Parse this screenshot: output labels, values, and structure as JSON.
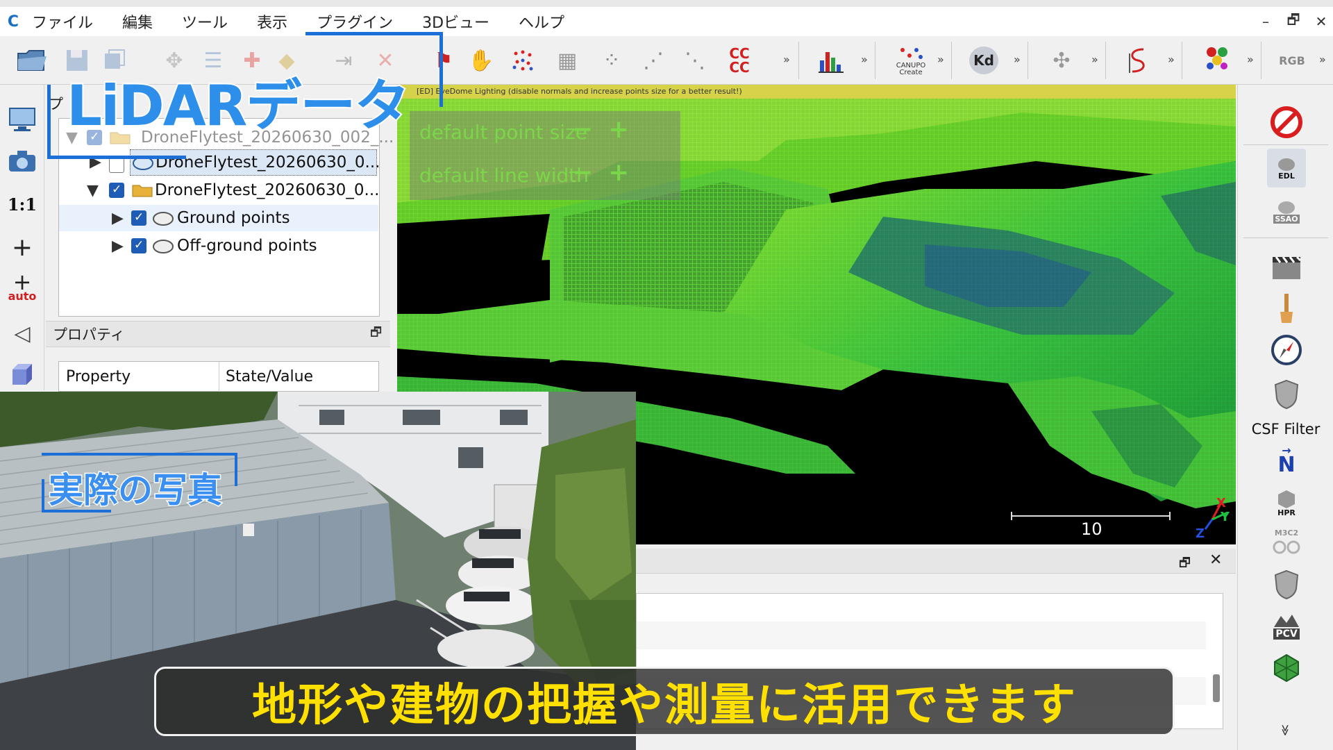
{
  "menu": {
    "logo": "C",
    "items": [
      "ファイル",
      "編集",
      "ツール",
      "表示",
      "プラグイン",
      "3Dビュー",
      "ヘルプ"
    ]
  },
  "window_controls": {
    "minimize": "–",
    "restore": "🗗",
    "close": "✕"
  },
  "toolbar": {
    "overflow": "»",
    "icons": [
      "open-folder-icon",
      "save-icon",
      "clone-icon",
      "translate-icon",
      "list-icon",
      "add-point-icon",
      "color-icon",
      "export-icon",
      "delete-icon",
      "sf-icon",
      "segment-icon",
      "hand-icon",
      "noise-icon",
      "mesh-icon",
      "scatter-icon",
      "subsample-icon",
      "sparse-icon",
      "cc-compare-icon",
      "histogram-icon",
      "canupo-create-icon",
      "kdtree-icon",
      "puzzle-icon",
      "spline-icon",
      "train-icon",
      "rgb-icon"
    ],
    "cc_label": "CC CC",
    "kd_label": "Kd",
    "canupo_label": "CANUPO Create",
    "rgb_label": "RGB"
  },
  "left_toolbar": {
    "scale_label": "1:1",
    "auto_label": "auto"
  },
  "db_tree": {
    "panel_label": "プ",
    "rows": [
      {
        "label": "DroneFlytest_20260630_002_...",
        "expanded": true,
        "checked": true,
        "type": "folder",
        "indent": 0,
        "faded": true
      },
      {
        "label": "DroneFlytest_20260630_0...",
        "expanded": false,
        "checked": false,
        "type": "cloud",
        "indent": 1,
        "selected": true
      },
      {
        "label": "DroneFlytest_20260630_0...",
        "expanded": true,
        "checked": true,
        "type": "folder",
        "indent": 1
      },
      {
        "label": "Ground points",
        "expanded": false,
        "checked": true,
        "type": "cloud",
        "indent": 2,
        "hover": true
      },
      {
        "label": "Off-ground points",
        "expanded": false,
        "checked": true,
        "type": "cloud",
        "indent": 2
      }
    ]
  },
  "properties": {
    "title": "プロパティ",
    "col_property": "Property",
    "col_value": "State/Value"
  },
  "view3d": {
    "edl_banner": "[ED] EyeDome Lighting (disable normals and increase points size for a better result!)",
    "hud_point_size": "default point size",
    "hud_line_width": "default line width",
    "minus": "−",
    "plus": "+",
    "scale_value": "10",
    "axis_x": "X",
    "axis_y": "Y",
    "axis_z": "Z"
  },
  "right_toolbar": {
    "edl_label": "EDL",
    "ssao_label": "SSAO",
    "csf_label": "CSF Filter",
    "north_label": "N",
    "hpr_label": "HPR",
    "m3c2_label": "M3C2",
    "pcv_label": "PCV",
    "more": "≫"
  },
  "overlays": {
    "lidar_title": "LiDARデータ",
    "photo_label": "実際の写真",
    "subtitle": "地形や建物の把握や測量に活用できます"
  },
  "colors": {
    "accent_blue": "#1c6fd6",
    "subtitle_yellow": "#ffe000",
    "hud_green": "#7cd64a"
  }
}
